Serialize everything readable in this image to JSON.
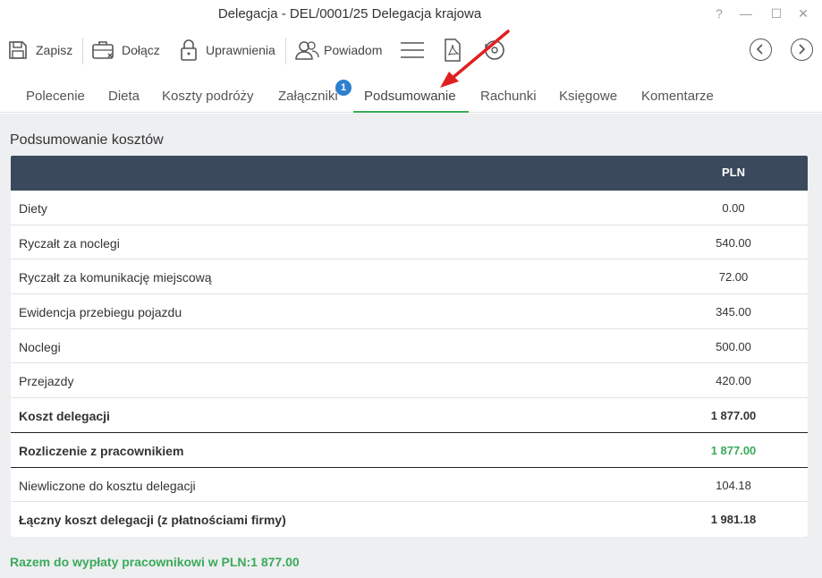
{
  "window": {
    "title": "Delegacja - DEL/0001/25 Delegacja krajowa",
    "help_label": "?",
    "minimize_label": "—",
    "maximize_label": "☐",
    "close_label": "✕"
  },
  "toolbar": {
    "save_label": "Zapisz",
    "attach_label": "Dołącz",
    "permissions_label": "Uprawnienia",
    "notify_label": "Powiadom"
  },
  "tabs": [
    {
      "label": "Polecenie"
    },
    {
      "label": "Dieta"
    },
    {
      "label": "Koszty podróży"
    },
    {
      "label": "Załączniki",
      "badge": "1"
    },
    {
      "label": "Podsumowanie",
      "active": true
    },
    {
      "label": "Rachunki"
    },
    {
      "label": "Księgowe"
    },
    {
      "label": "Komentarze"
    }
  ],
  "summary": {
    "title": "Podsumowanie kosztów",
    "currency_header": "PLN",
    "rows": [
      {
        "label": "Diety",
        "value": "0.00"
      },
      {
        "label": "Ryczałt za noclegi",
        "value": "540.00"
      },
      {
        "label": "Ryczałt za komunikację miejscową",
        "value": "72.00"
      },
      {
        "label": "Ewidencja przebiegu pojazdu",
        "value": "345.00"
      },
      {
        "label": "Noclegi",
        "value": "500.00"
      },
      {
        "label": "Przejazdy",
        "value": "420.00"
      },
      {
        "label": "Koszt delegacji",
        "value": "1 877.00"
      },
      {
        "label": "Rozliczenie z pracownikiem",
        "value": "1 877.00"
      },
      {
        "label": "Niewliczone do kosztu delegacji",
        "value": "104.18"
      },
      {
        "label": "Łączny koszt delegacji (z płatnościami firmy)",
        "value": "1 981.18"
      }
    ],
    "footer": "Razem do wypłaty pracownikowi w PLN:1 877.00"
  },
  "colors": {
    "accent_green": "#3aaa5a",
    "header_dark": "#3a4a5c",
    "badge_blue": "#2f7fd1",
    "arrow_red": "#e02020"
  }
}
